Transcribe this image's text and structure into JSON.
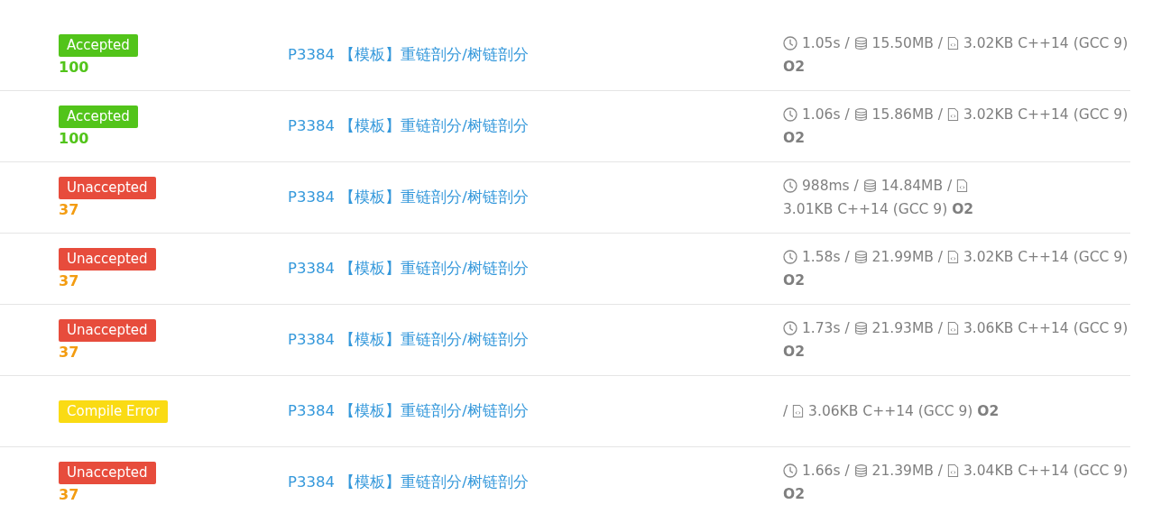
{
  "records": [
    {
      "status": {
        "kind": "accepted",
        "label": "Accepted"
      },
      "score": "100",
      "problem": "P3384 【模板】重链剖分/树链剖分",
      "stats": [
        {
          "kind": "time",
          "text": "1.05s /"
        },
        {
          "kind": "memory",
          "text": "15.50MB /"
        },
        {
          "kind": "code",
          "text": "3.02KB C++14 (GCC 9)"
        }
      ],
      "option": "O2"
    },
    {
      "status": {
        "kind": "accepted",
        "label": "Accepted"
      },
      "score": "100",
      "problem": "P3384 【模板】重链剖分/树链剖分",
      "stats": [
        {
          "kind": "time",
          "text": "1.06s /"
        },
        {
          "kind": "memory",
          "text": "15.86MB /"
        },
        {
          "kind": "code",
          "text": "3.02KB C++14 (GCC 9)"
        }
      ],
      "option": "O2"
    },
    {
      "status": {
        "kind": "unaccepted",
        "label": "Unaccepted"
      },
      "score": "37",
      "problem": "P3384 【模板】重链剖分/树链剖分",
      "stats": [
        {
          "kind": "time",
          "text": "988ms /"
        },
        {
          "kind": "memory",
          "text": "14.84MB /"
        },
        {
          "kind": "code",
          "text": "3.01KB C++14 (GCC 9)"
        }
      ],
      "option": "O2"
    },
    {
      "status": {
        "kind": "unaccepted",
        "label": "Unaccepted"
      },
      "score": "37",
      "problem": "P3384 【模板】重链剖分/树链剖分",
      "stats": [
        {
          "kind": "time",
          "text": "1.58s /"
        },
        {
          "kind": "memory",
          "text": "21.99MB /"
        },
        {
          "kind": "code",
          "text": "3.02KB C++14 (GCC 9)"
        }
      ],
      "option": "O2"
    },
    {
      "status": {
        "kind": "unaccepted",
        "label": "Unaccepted"
      },
      "score": "37",
      "problem": "P3384 【模板】重链剖分/树链剖分",
      "stats": [
        {
          "kind": "time",
          "text": "1.73s /"
        },
        {
          "kind": "memory",
          "text": "21.93MB /"
        },
        {
          "kind": "code",
          "text": "3.06KB C++14 (GCC 9)"
        }
      ],
      "option": "O2"
    },
    {
      "status": {
        "kind": "compile_error",
        "label": "Compile Error"
      },
      "problem": "P3384 【模板】重链剖分/树链剖分",
      "stats": [
        {
          "kind": "separator",
          "text": "/"
        },
        {
          "kind": "code",
          "text": "3.06KB C++14 (GCC 9)"
        }
      ],
      "option": "O2"
    },
    {
      "status": {
        "kind": "unaccepted",
        "label": "Unaccepted"
      },
      "score": "37",
      "problem": "P3384 【模板】重链剖分/树链剖分",
      "stats": [
        {
          "kind": "time",
          "text": "1.66s /"
        },
        {
          "kind": "memory",
          "text": "21.39MB /"
        },
        {
          "kind": "code",
          "text": "3.04KB C++14 (GCC 9)"
        }
      ],
      "option": "O2"
    }
  ]
}
